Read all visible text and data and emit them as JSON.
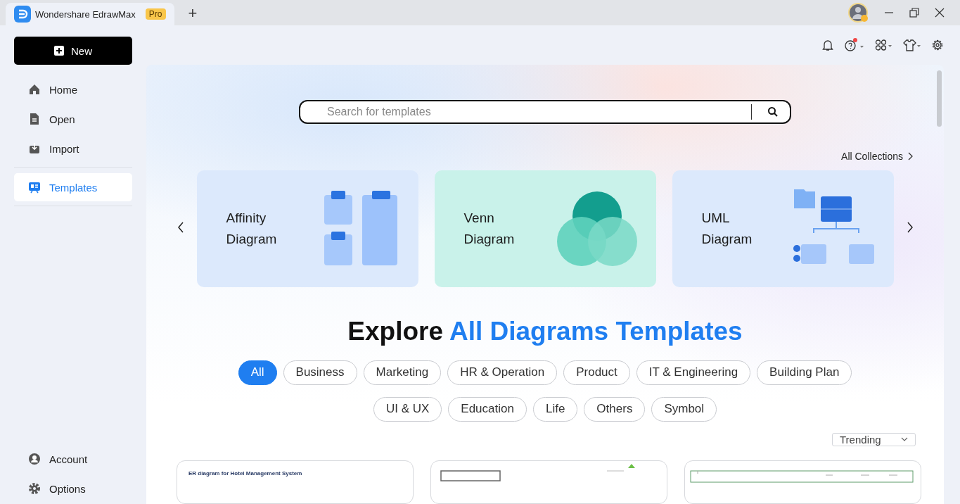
{
  "window": {
    "tab_title": "Wondershare EdrawMax",
    "badge": "Pro",
    "new_tab": "+"
  },
  "sidebar": {
    "new_button": "New",
    "items": [
      {
        "label": "Home",
        "kind": "home",
        "selected": false
      },
      {
        "label": "Open",
        "kind": "file",
        "selected": false
      },
      {
        "label": "Import",
        "kind": "import",
        "selected": false
      },
      {
        "label": "Templates",
        "kind": "templates",
        "selected": true
      }
    ],
    "bottom_items": [
      {
        "label": "Account",
        "kind": "account",
        "selected": false
      },
      {
        "label": "Options",
        "kind": "options",
        "selected": false
      }
    ]
  },
  "toolbar": {
    "help_has_notification": true
  },
  "search": {
    "placeholder": "Search for templates"
  },
  "all_collections": "All Collections",
  "featured": [
    {
      "title": "Affinity Diagram",
      "kind": "affinity"
    },
    {
      "title": "Venn Diagram",
      "kind": "venn"
    },
    {
      "title": "UML Diagram",
      "kind": "uml"
    }
  ],
  "heading": {
    "plain": "Explore",
    "highlight": "All Diagrams Templates"
  },
  "filters": [
    [
      {
        "label": "All",
        "selected": true
      },
      {
        "label": "Business",
        "selected": false
      },
      {
        "label": "Marketing",
        "selected": false
      },
      {
        "label": "HR & Operation",
        "selected": false
      },
      {
        "label": "Product",
        "selected": false
      },
      {
        "label": "IT & Engineering",
        "selected": false
      },
      {
        "label": "Building Plan",
        "selected": false
      }
    ],
    [
      {
        "label": "UI & UX",
        "selected": false
      },
      {
        "label": "Education",
        "selected": false
      },
      {
        "label": "Life",
        "selected": false
      },
      {
        "label": "Others",
        "selected": false
      },
      {
        "label": "Symbol",
        "selected": false
      }
    ]
  ],
  "sort": {
    "value": "Trending"
  },
  "template_cards": [
    {
      "kind": "er",
      "caption": "ER diagram for Hotel Management System"
    },
    {
      "kind": "floorplan"
    },
    {
      "kind": "table"
    }
  ]
}
